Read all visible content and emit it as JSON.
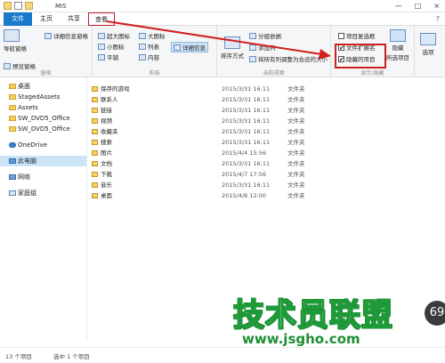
{
  "window": {
    "title": "MIS",
    "minimize": "—",
    "maximize": "□",
    "close": "×"
  },
  "tabs": [
    {
      "label": "文件"
    },
    {
      "label": "主页"
    },
    {
      "label": "共享"
    },
    {
      "label": "查看"
    }
  ],
  "ribbon": {
    "panes": {
      "nav_pane": "导航窗格",
      "preview_pane": "预览窗格",
      "details_pane": "详细信息窗格",
      "group_label": "窗格"
    },
    "layout": {
      "extra_large": "超大图标",
      "large": "大图标",
      "small": "小图标",
      "list": "列表",
      "tiles": "平铺",
      "content": "内容",
      "details": "详细信息",
      "group_label": "布局"
    },
    "current_view": {
      "sort_by": "排序方式",
      "group_by": "分组依据",
      "add_columns": "添加列",
      "size_columns": "将所有列调整为合适的大小",
      "group_label": "当前视图"
    },
    "show_hide": {
      "item_checkboxes": "项目复选框",
      "file_extensions": "文件扩展名",
      "hidden_items": "隐藏的项目",
      "hide_selected": "隐藏",
      "hide_selected_2": "所选项目",
      "group_label": "显示/隐藏",
      "check_mark": "✔"
    },
    "options": "选项"
  },
  "nav_items": [
    {
      "label": "桌面"
    },
    {
      "label": "StagedAssets"
    },
    {
      "label": "Assets"
    },
    {
      "label": "SW_DVD5_Office"
    },
    {
      "label": "SW_DVD5_Office"
    },
    {
      "label": "OneDrive"
    },
    {
      "label": "此电脑"
    },
    {
      "label": "网络"
    },
    {
      "label": "家庭组"
    }
  ],
  "files": [
    {
      "name": "保存的游戏",
      "date": "2015/3/31 16:11",
      "type": "文件夹"
    },
    {
      "name": "联系人",
      "date": "2015/3/31 16:11",
      "type": "文件夹"
    },
    {
      "name": "链接",
      "date": "2015/3/31 16:11",
      "type": "文件夹"
    },
    {
      "name": "视频",
      "date": "2015/3/31 16:11",
      "type": "文件夹"
    },
    {
      "name": "收藏夹",
      "date": "2015/3/31 16:11",
      "type": "文件夹"
    },
    {
      "name": "搜索",
      "date": "2015/3/31 16:11",
      "type": "文件夹"
    },
    {
      "name": "图片",
      "date": "2015/4/4 15:56",
      "type": "文件夹"
    },
    {
      "name": "文档",
      "date": "2015/3/31 16:11",
      "type": "文件夹"
    },
    {
      "name": "下载",
      "date": "2015/4/7 17:56",
      "type": "文件夹"
    },
    {
      "name": "音乐",
      "date": "2015/3/31 16:11",
      "type": "文件夹"
    },
    {
      "name": "桌面",
      "date": "2015/4/8 12:00",
      "type": "文件夹"
    }
  ],
  "status": {
    "count": "13 个项目",
    "selected": "选中 1 个项目"
  },
  "watermark": {
    "text": "技术员联盟",
    "url": "www.jsgho.com",
    "badge": "69"
  },
  "colors": {
    "accent": "#1979ca",
    "highlight": "#d0201e",
    "watermark": "#1f9a39"
  }
}
